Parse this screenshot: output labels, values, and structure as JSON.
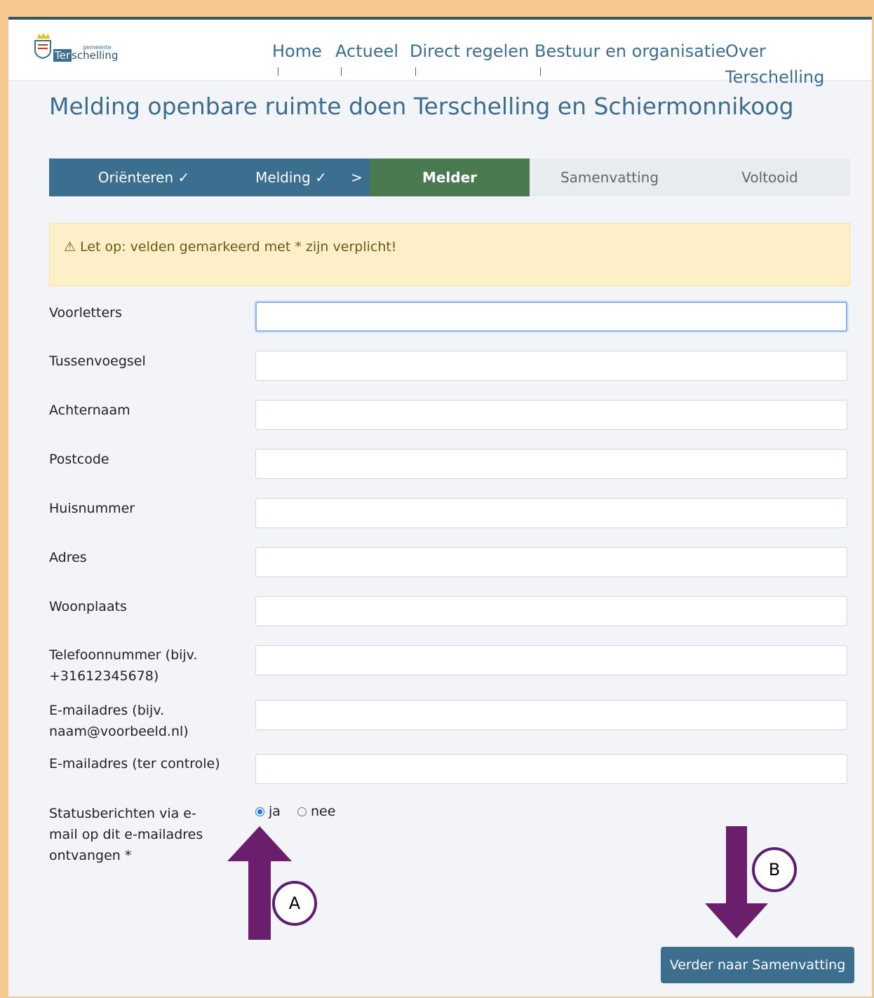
{
  "header": {
    "logo_small": "gemeente",
    "logo_ter": "Ter",
    "logo_rest": "schelling",
    "nav": [
      "Home",
      "Actueel",
      "Direct regelen",
      "Bestuur en organisatie",
      "Over",
      "Terschelling"
    ]
  },
  "page_title": "Melding openbare ruimte doen Terschelling en Schiermonnikoog",
  "steps": [
    "Oriënteren ✓",
    "Melding ✓",
    ">",
    "Melder",
    "Samenvatting",
    "Voltooid"
  ],
  "warning": "⚠ Let op: velden gemarkeerd met * zijn verplicht!",
  "fields": [
    {
      "label": "Voorletters",
      "value": ""
    },
    {
      "label": "Tussenvoegsel",
      "value": ""
    },
    {
      "label": "Achternaam",
      "value": ""
    },
    {
      "label": "Postcode",
      "value": ""
    },
    {
      "label": "Huisnummer",
      "value": ""
    },
    {
      "label": "Adres",
      "value": ""
    },
    {
      "label": "Woonplaats",
      "value": ""
    },
    {
      "label": "Telefoonnummer (bijv. +31612345678)",
      "value": ""
    },
    {
      "label": "E-mailadres (bijv. naam@voorbeeld.nl)",
      "value": ""
    },
    {
      "label": "E-mailadres (ter controle)",
      "value": ""
    }
  ],
  "status_question": "Statusberichten via e-mail op dit e-mailadres ontvangen *",
  "radio_options": [
    "ja",
    "nee"
  ],
  "radio_selected": "ja",
  "next_button": "Verder naar Samenvatting",
  "annotations": [
    "A",
    "B"
  ],
  "colors": {
    "primary": "#3c6e8f",
    "active_step": "#4a7a50",
    "arrow": "#6b1e6b",
    "frame": "#f5c98e"
  }
}
